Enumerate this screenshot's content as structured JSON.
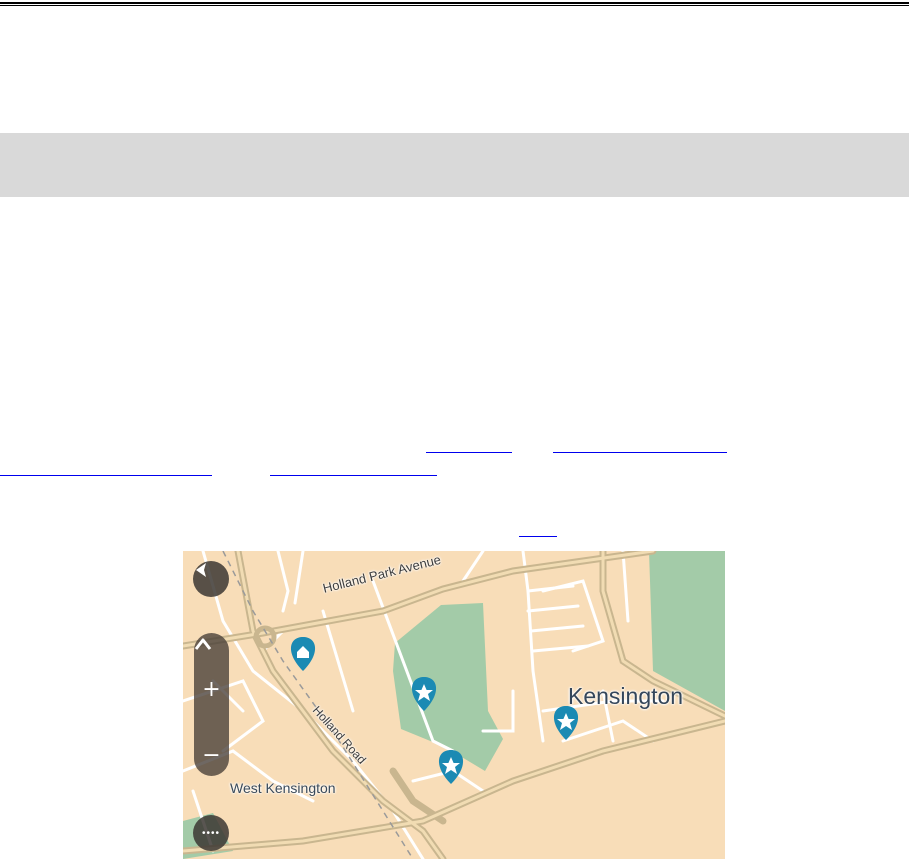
{
  "document": {
    "links": [
      "",
      "",
      "",
      "",
      ""
    ]
  },
  "map": {
    "colors": {
      "land": "#f8ddb8",
      "park": "#a3cba8",
      "road_major": "#c9b68f",
      "road_minor": "#ffffff",
      "rail": "#9a9a9a",
      "pin": "#1b8ab3",
      "control_bg": "#3f3933"
    },
    "labels": {
      "district": "Kensington",
      "area": "West Kensington",
      "street_1": "Holland Park Avenue",
      "street_2": "Holland Road"
    },
    "controls": {
      "back_icon": "back-arrow-icon",
      "north_icon": "compass-arrow-icon",
      "zoom_in": "+",
      "zoom_out": "−",
      "menu": "••••"
    },
    "pins": [
      {
        "type": "home",
        "icon": "home-icon"
      },
      {
        "type": "favourite",
        "icon": "star-icon"
      },
      {
        "type": "favourite",
        "icon": "star-icon"
      },
      {
        "type": "favourite",
        "icon": "star-icon"
      }
    ]
  }
}
